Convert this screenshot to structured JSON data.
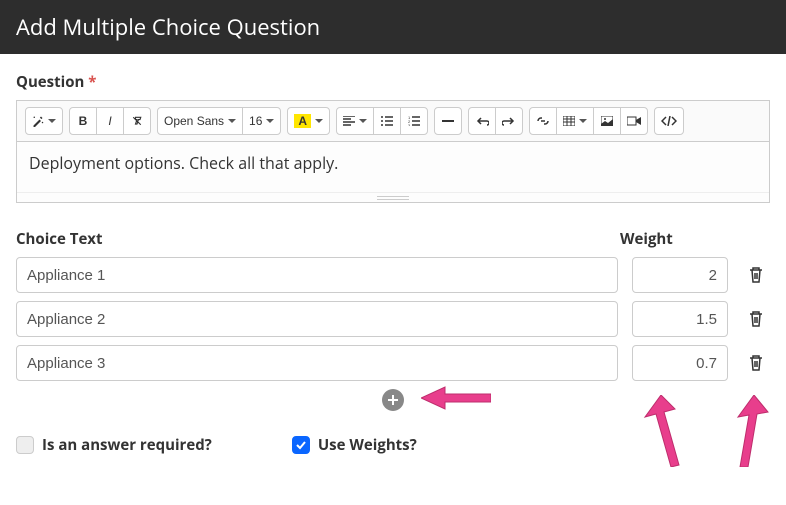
{
  "header": {
    "title": "Add Multiple Choice Question"
  },
  "question": {
    "label": "Question",
    "required_marker": "*",
    "body": "Deployment options.  Check all that apply."
  },
  "toolbar": {
    "font_family_label": "Open Sans",
    "font_size_label": "16"
  },
  "choices": {
    "text_header": "Choice Text",
    "weight_header": "Weight",
    "rows": [
      {
        "text": "Appliance 1",
        "weight": "2"
      },
      {
        "text": "Appliance 2",
        "weight": "1.5"
      },
      {
        "text": "Appliance 3",
        "weight": "0.7"
      }
    ]
  },
  "options": {
    "required_label": "Is an answer required?",
    "required_checked": false,
    "weights_label": "Use Weights?",
    "weights_checked": true
  }
}
